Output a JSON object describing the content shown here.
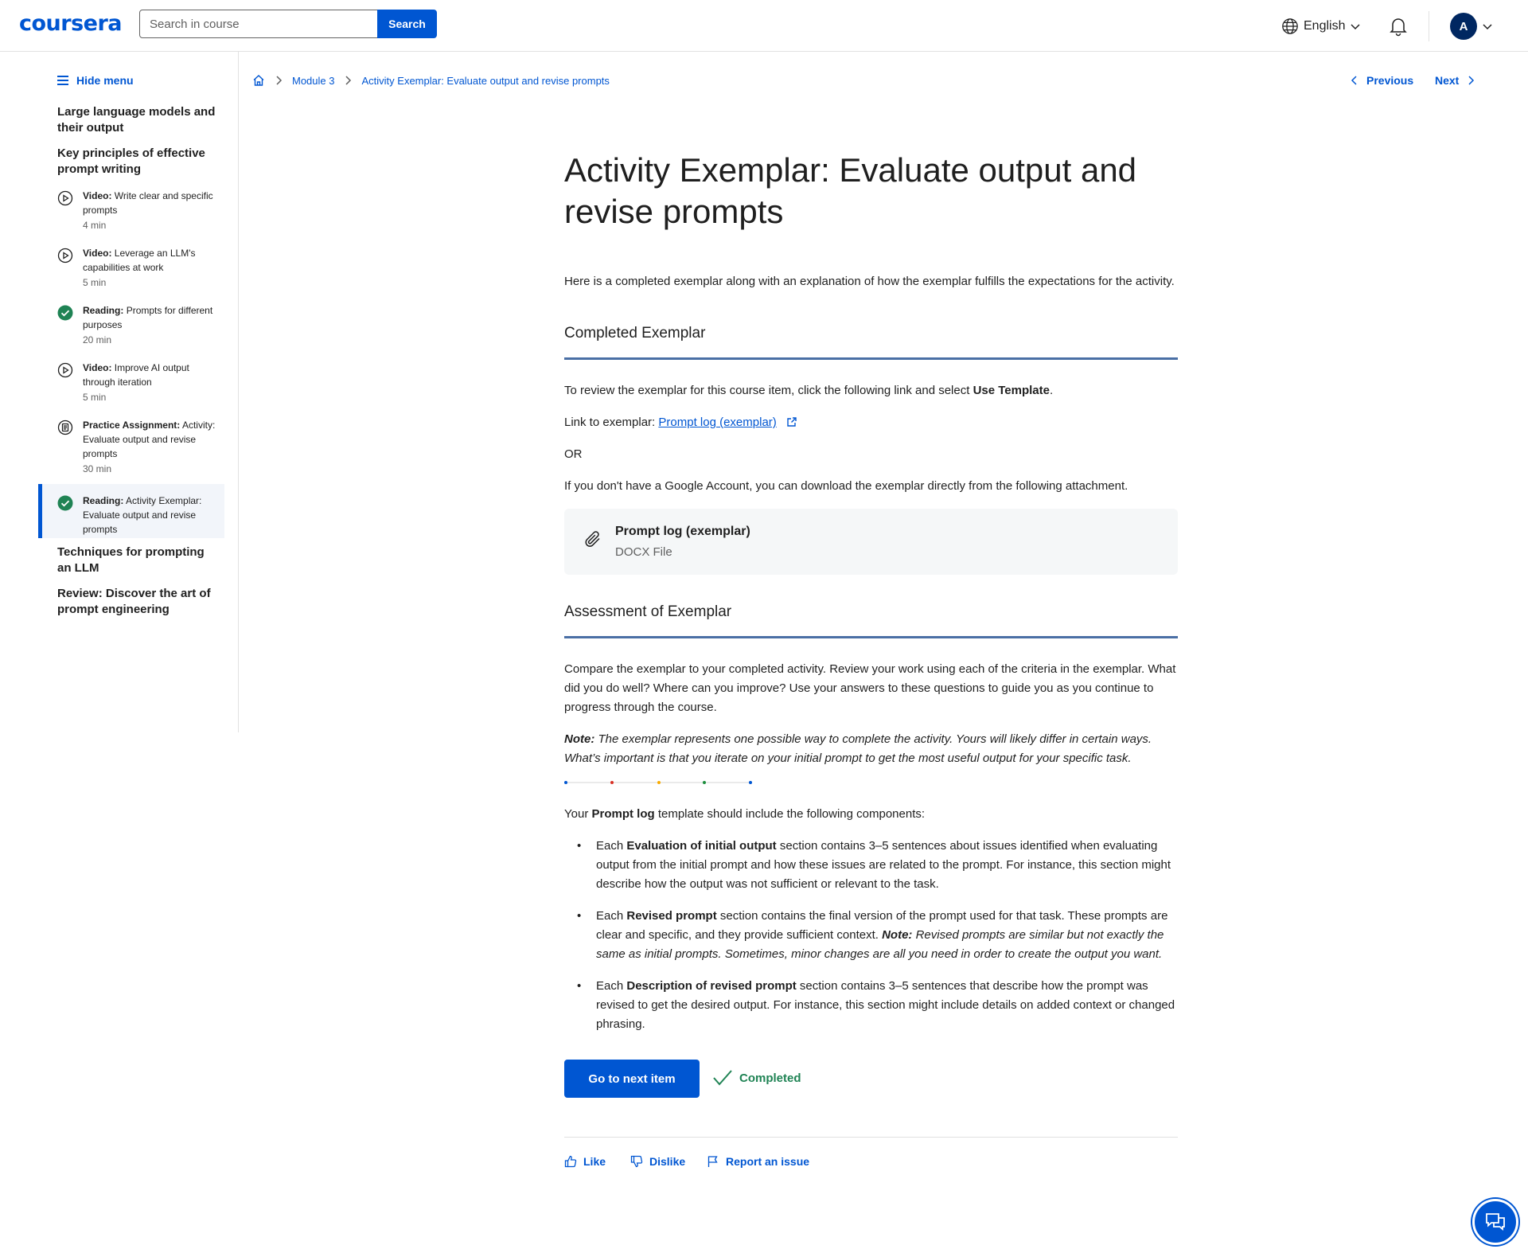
{
  "header": {
    "logo": "coursera",
    "search_placeholder": "Search in course",
    "search_button": "Search",
    "language": "English",
    "avatar_initial": "A"
  },
  "sidebar": {
    "hide_menu": "Hide menu",
    "sections": {
      "s1": "Large language models and their output",
      "s2": "Key principles of effective prompt writing",
      "s3": "Techniques for prompting an LLM",
      "s4": "Review: Discover the art of prompt engineering"
    },
    "items": [
      {
        "kind": "Video:",
        "title": "Write clear and specific prompts",
        "duration": "4 min",
        "icon": "play-icon"
      },
      {
        "kind": "Video:",
        "title": "Leverage an LLM's capabilities at work",
        "duration": "5 min",
        "icon": "play-icon"
      },
      {
        "kind": "Reading:",
        "title": "Prompts for different purposes",
        "duration": "20 min",
        "icon": "completed-check-icon"
      },
      {
        "kind": "Video:",
        "title": "Improve AI output through iteration",
        "duration": "5 min",
        "icon": "play-icon"
      },
      {
        "kind": "Practice Assignment:",
        "title": "Activity: Evaluate output and revise prompts",
        "duration": "30 min",
        "icon": "assignment-icon"
      },
      {
        "kind": "Reading:",
        "title": "Activity Exemplar: Evaluate output and revise prompts",
        "duration": "",
        "icon": "completed-check-icon"
      }
    ]
  },
  "breadcrumb": {
    "module": "Module 3",
    "current": "Activity Exemplar: Evaluate output and revise prompts"
  },
  "nav": {
    "previous": "Previous",
    "next": "Next"
  },
  "content": {
    "title": "Activity Exemplar: Evaluate output and revise prompts",
    "intro": "Here is a completed exemplar along with an explanation of how the exemplar fulfills the expectations for the activity.",
    "completed_heading": "Completed Exemplar",
    "review_pre": "To review the exemplar for this course item, click the following link and select ",
    "review_bold": "Use Template",
    "review_post": ".",
    "link_label": "Link to exemplar: ",
    "link_text": "Prompt log (exemplar)",
    "or": "OR",
    "no_google": "If you don't have a Google Account, you can download the exemplar directly from the following attachment.",
    "attachment_name": "Prompt log (exemplar)",
    "attachment_type": "DOCX File",
    "assessment_heading": "Assessment of Exemplar",
    "compare": "Compare the exemplar to your completed activity. Review your work using each of the criteria in the exemplar. What did you do well? Where can you improve? Use your answers to these questions to guide you as you continue to progress through the course.",
    "note_label": "Note:",
    "note_text": " The exemplar represents one possible way to complete the activity. Yours will likely differ in certain ways. What’s important is that you iterate on your initial prompt to get the most useful output for your specific task.",
    "template_pre": "Your ",
    "template_bold": "Prompt log",
    "template_post": " template should include the following components:",
    "bullets": [
      {
        "pre": "Each ",
        "bold": "Evaluation of initial output",
        "post": " section contains 3–5 sentences about issues identified when evaluating output from the initial prompt and how these issues are related to the prompt. For instance, this section might describe how the output was not sufficient or relevant to the task."
      },
      {
        "pre": "Each ",
        "bold": "Revised prompt",
        "post": " section contains the final version of the prompt used for that task. These prompts are clear and specific, and they provide sufficient context. ",
        "note_label": "Note:",
        "note_text": " Revised prompts are similar but not exactly the same as initial prompts. Sometimes, minor changes are all you need in order to create the output you want."
      },
      {
        "pre": "Each ",
        "bold": "Description of revised prompt",
        "post": " section contains 3–5 sentences that describe how the prompt was revised to get the desired output. For instance, this section might include details on added context or changed phrasing."
      }
    ],
    "next_button": "Go to next item",
    "completed": "Completed",
    "like": "Like",
    "dislike": "Dislike",
    "report": "Report an issue"
  },
  "colors": {
    "brand": "#0056d2",
    "success": "#1f8354",
    "divider_dots": [
      "#0056d2",
      "#d93025",
      "#f9ab00",
      "#1e8e3e",
      "#0056d2"
    ]
  }
}
